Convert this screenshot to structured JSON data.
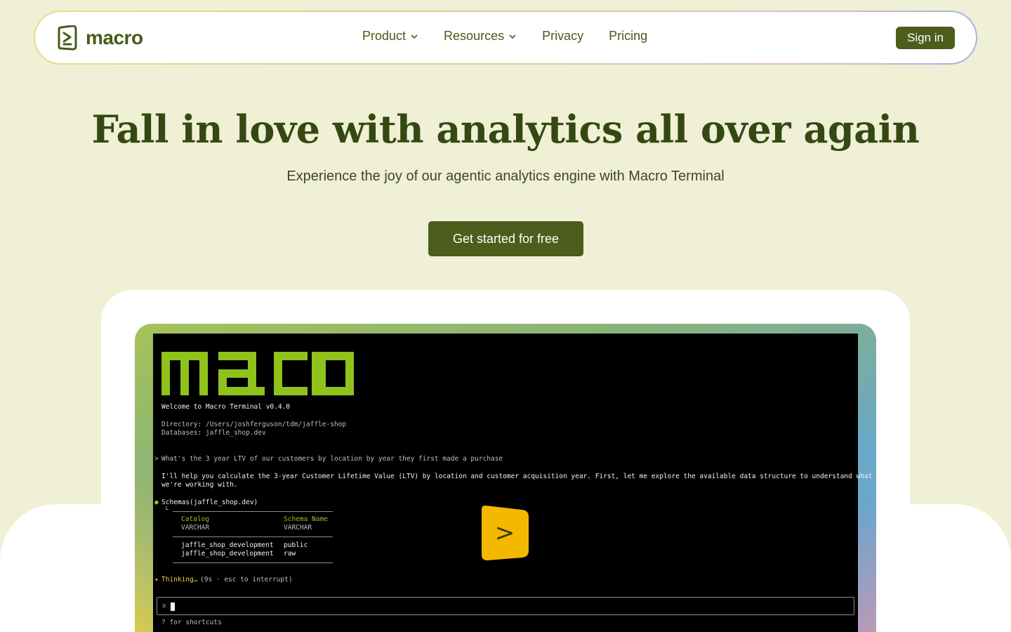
{
  "nav": {
    "logo_text": "macro",
    "links": [
      {
        "label": "Product",
        "has_dropdown": true
      },
      {
        "label": "Resources",
        "has_dropdown": true
      },
      {
        "label": "Privacy",
        "has_dropdown": false
      },
      {
        "label": "Pricing",
        "has_dropdown": false
      }
    ],
    "signin_label": "Sign in"
  },
  "hero": {
    "title": "Fall in love with analytics all over again",
    "subtitle": "Experience the joy of our agentic analytics engine with Macro Terminal",
    "cta_label": "Get started for free"
  },
  "terminal": {
    "banner": "macro",
    "welcome": "Welcome to Macro Terminal v0.4.0",
    "directory": "Directory: /Users/joshferguson/tdm/jaffle-shop",
    "databases": "Databases: jaffle_shop.dev",
    "prompt_marker": ">",
    "query": "What's the 3 year LTV of our customers by location by year they first made a purchase",
    "response_line1": "I'll help you calculate the 3-year Customer Lifetime Value (LTV) by location and customer acquisition year. First, let me explore the available data structure to understand what",
    "response_line2": "we're working with.",
    "tool_bullet": "●",
    "tool_call": "Schemas(jaffle_shop.dev)",
    "tree_glyph": "└",
    "table": {
      "headers": [
        "Catalog",
        "Schema Name"
      ],
      "types": [
        "VARCHAR",
        "VARCHAR"
      ],
      "rows": [
        [
          "jaffle_shop_development",
          "public"
        ],
        [
          "jaffle_shop_development",
          "raw"
        ]
      ]
    },
    "thinking_star": "✦",
    "thinking_label": "Thinking…",
    "thinking_hint": "(9s · esc to interrupt)",
    "input_prompt": "≥",
    "shortcuts_hint": "? for shortcuts"
  },
  "play_icon_glyph": ">",
  "colors": {
    "background": "#eff0d6",
    "brand": "#4d5d1b",
    "terminal_green": "#8fc21a",
    "play_yellow": "#f5b800"
  }
}
